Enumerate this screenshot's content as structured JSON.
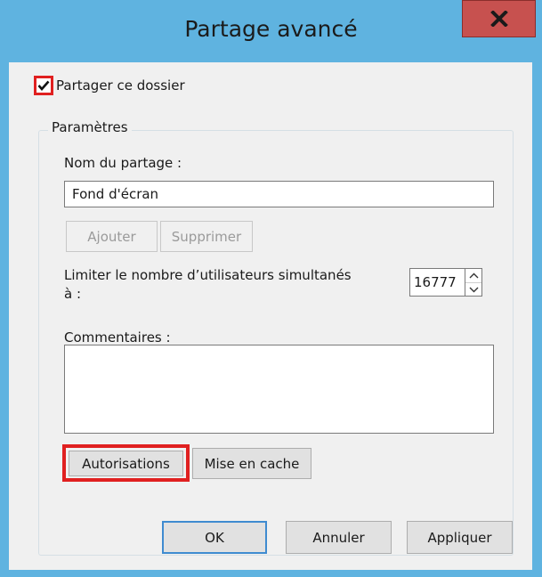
{
  "window": {
    "title": "Partage avancé"
  },
  "share_checkbox": {
    "label": "Partager ce dossier",
    "checked": true
  },
  "parameters": {
    "legend": "Paramètres",
    "share_name_label": "Nom du partage :",
    "share_name_value": "Fond d'écran",
    "add_button": "Ajouter",
    "remove_button": "Supprimer",
    "limit_label_line1": "Limiter le nombre d’utilisateurs simultanés",
    "limit_label_line2": "à :",
    "limit_value": "16777",
    "comments_label": "Commentaires :",
    "comments_value": "",
    "permissions_button": "Autorisations",
    "caching_button": "Mise en cache"
  },
  "footer": {
    "ok_button": "OK",
    "cancel_button": "Annuler",
    "apply_button": "Appliquer"
  },
  "colors": {
    "frame": "#5fb3e0",
    "close_button": "#c7514f",
    "highlight": "#e02020",
    "client_bg": "#f0f0f0"
  }
}
